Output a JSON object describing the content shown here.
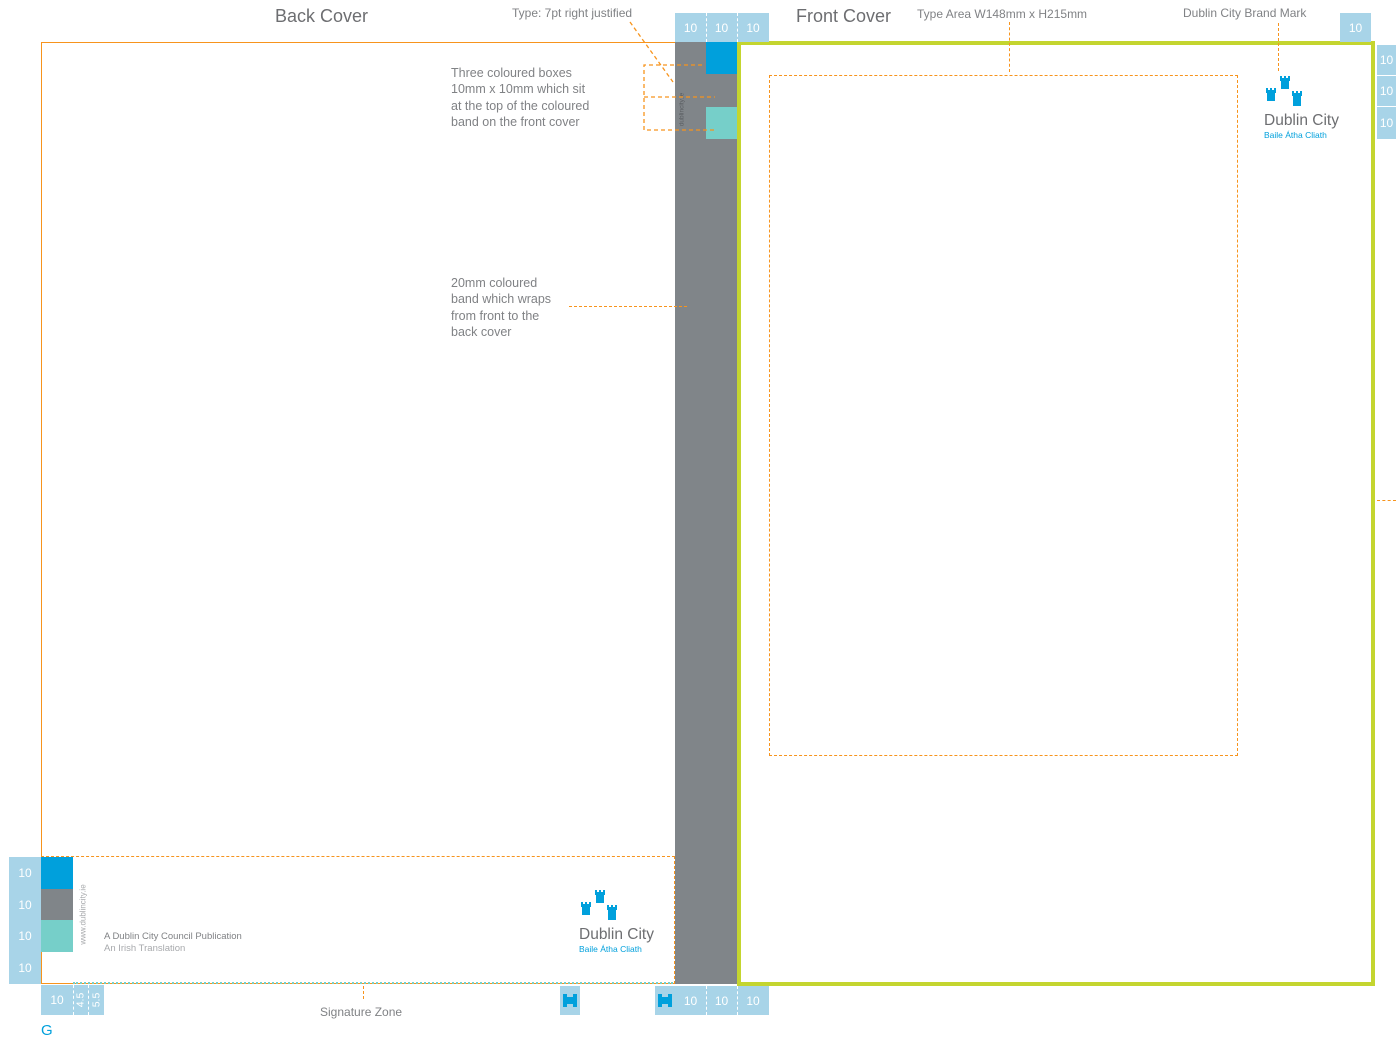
{
  "titles": {
    "back_cover": "Back Cover",
    "front_cover": "Front Cover"
  },
  "annotations": {
    "type_note": "Type: 7pt right justified",
    "type_area": "Type Area W148mm x H215mm",
    "brand_mark": "Dublin City Brand Mark",
    "boxes_note": [
      "Three coloured boxes",
      "10mm x 10mm which sit",
      "at the top of the coloured",
      "band on the front cover"
    ],
    "band_note": [
      "20mm coloured",
      "band which wraps",
      "from front to the",
      "back cover"
    ],
    "signature_zone": "Signature Zone"
  },
  "logo": {
    "name": "Dublin City",
    "sub": "Baile Átha Cliath"
  },
  "back_footer": {
    "publication": "A Dublin City Council Publication",
    "translation": "An Irish Translation",
    "website": "www.dublincity.ie",
    "spine_text": "dublincity.ie"
  },
  "measures": {
    "ten": "10",
    "four_five": "4.5",
    "five_five": "5.5"
  },
  "page_letter": "G",
  "colors": {
    "guide_orange": "#f7941d",
    "front_border": "#c4d52f",
    "band_grey": "#808589",
    "box_blue": "#00a0dc",
    "box_teal": "#76cfc9",
    "measure_blue": "#a8d4e8"
  }
}
